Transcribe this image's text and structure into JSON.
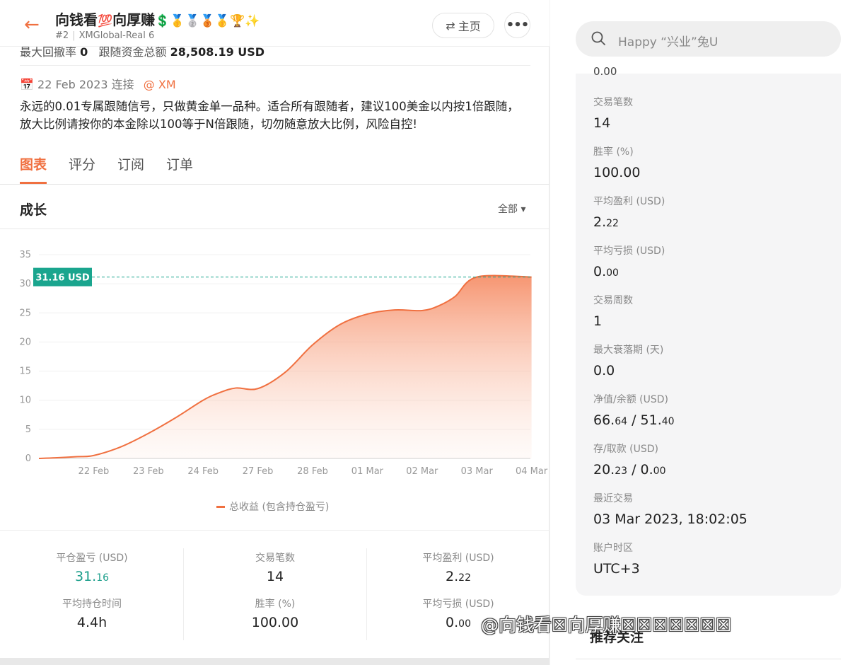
{
  "header": {
    "back_icon": "arrow-left-icon",
    "title": "向钱看💯向厚赚💲🥇🥈🥉🥇🏆✨",
    "title_text": "向钱看",
    "title_text2": "向厚赚",
    "title_emojis1": "💯",
    "title_emojis2": "💲🥇🥈🥉🥇🏆✨",
    "rank": "#2",
    "server": "XMGlobal-Real 6",
    "home_label": "主页",
    "more_icon": "more-dots-icon"
  },
  "peek": {
    "drawdown_label": "最大回撤率",
    "drawdown_value": "0",
    "follow_label": "跟随资金总额",
    "follow_value": "28,508.19 USD"
  },
  "signal": {
    "connected_date": "22 Feb 2023 连接",
    "broker": "@ XM",
    "description": "永远的0.01专属跟随信号，只做黄金单一品种。适合所有跟随者，建议100美金以内按1倍跟随，放大比例请按你的本金除以100等于N倍跟随，切勿随意放大比例，风险自控!"
  },
  "tabs": [
    {
      "label": "图表",
      "active": true
    },
    {
      "label": "评分",
      "active": false
    },
    {
      "label": "订阅",
      "active": false
    },
    {
      "label": "订单",
      "active": false
    }
  ],
  "growth": {
    "title": "成长",
    "range_label": "全部"
  },
  "chart_data": {
    "type": "area",
    "series": [
      {
        "name": "总收益 (包含持仓盈亏)",
        "color": "#f07040"
      }
    ],
    "x_ticks": [
      "22 Feb",
      "23 Feb",
      "24 Feb",
      "27 Feb",
      "28 Feb",
      "01 Mar",
      "02 Mar",
      "03 Mar",
      "04 Mar"
    ],
    "y_ticks": [
      0,
      5,
      10,
      15,
      20,
      25,
      30,
      35
    ],
    "ylim": [
      0,
      35
    ],
    "x": [
      -1,
      -0.7,
      -0.3,
      0,
      0.5,
      1,
      1.5,
      2,
      2.3,
      2.6,
      3,
      3.5,
      4,
      4.5,
      5,
      5.5,
      6,
      6.3,
      6.6,
      7,
      8
    ],
    "values": [
      0,
      0.1,
      0.3,
      0.5,
      2,
      4.3,
      7,
      10,
      11.3,
      12.1,
      12,
      14.8,
      19.5,
      23,
      24.8,
      25.5,
      25.4,
      26.2,
      27.8,
      31.16,
      31.16
    ],
    "current_label": "31.16 USD",
    "current_value": 31.16,
    "legend": "总收益 (包含持仓盈亏)",
    "grid": true
  },
  "stats": {
    "closed_pl_label": "平仓盈亏 (USD)",
    "closed_pl_int": "31.",
    "closed_pl_dec": "16",
    "trades_label": "交易笔数",
    "trades_value": "14",
    "avg_profit_label": "平均盈利 (USD)",
    "avg_profit_int": "2.",
    "avg_profit_dec": "22",
    "avg_hold_label": "平均持仓时间",
    "avg_hold_value": "4.4h",
    "win_rate_label": "胜率 (%)",
    "win_rate_value": "100.00",
    "avg_loss_label": "平均亏损 (USD)",
    "avg_loss_int": "0.",
    "avg_loss_dec": "00"
  },
  "search": {
    "icon": "search-icon",
    "placeholder": "Happy “兴业”兔U"
  },
  "panel": {
    "top_partial": "0.00",
    "items": [
      {
        "label": "交易笔数",
        "value": "14"
      },
      {
        "label": "胜率 (%)",
        "value": "100.00"
      },
      {
        "label": "平均盈利 (USD)",
        "int": "2.",
        "dec": "22"
      },
      {
        "label": "平均亏损 (USD)",
        "int": "0.",
        "dec": "00"
      },
      {
        "label": "交易周数",
        "value": "1"
      },
      {
        "label": "最大衰落期 (天)",
        "value": "0.0"
      },
      {
        "label": "净值/余额 (USD)",
        "int": "66.",
        "dec": "64",
        "sep": " / ",
        "int2": "51.",
        "dec2": "40"
      },
      {
        "label": "存/取款 (USD)",
        "int": "20.",
        "dec": "23",
        "sep": " / ",
        "int2": "0.",
        "dec2": "00"
      },
      {
        "label": "最近交易",
        "value": "03 Mar 2023, 18:02:05"
      },
      {
        "label": "账户时区",
        "value": "UTC+3"
      }
    ],
    "recommend_title": "推荐关注"
  },
  "watermark": "@向钱看☒向厚赚☒☒☒☒☒☒☒"
}
